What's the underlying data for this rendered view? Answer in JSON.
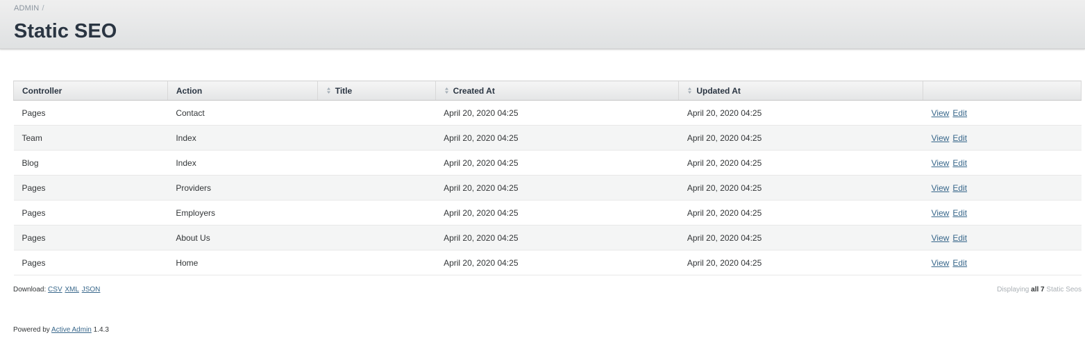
{
  "breadcrumb": {
    "items": [
      "ADMIN"
    ],
    "separator": "/"
  },
  "page": {
    "title": "Static SEO"
  },
  "table": {
    "columns": [
      {
        "label": "Controller",
        "sortable": false
      },
      {
        "label": "Action",
        "sortable": false
      },
      {
        "label": "Title",
        "sortable": true
      },
      {
        "label": "Created At",
        "sortable": true
      },
      {
        "label": "Updated At",
        "sortable": true
      },
      {
        "label": "",
        "sortable": false
      }
    ],
    "rows": [
      {
        "controller": "Pages",
        "action": "Contact",
        "title": "",
        "created_at": "April 20, 2020 04:25",
        "updated_at": "April 20, 2020 04:25",
        "view": "View",
        "edit": "Edit"
      },
      {
        "controller": "Team",
        "action": "Index",
        "title": "",
        "created_at": "April 20, 2020 04:25",
        "updated_at": "April 20, 2020 04:25",
        "view": "View",
        "edit": "Edit"
      },
      {
        "controller": "Blog",
        "action": "Index",
        "title": "",
        "created_at": "April 20, 2020 04:25",
        "updated_at": "April 20, 2020 04:25",
        "view": "View",
        "edit": "Edit"
      },
      {
        "controller": "Pages",
        "action": "Providers",
        "title": "",
        "created_at": "April 20, 2020 04:25",
        "updated_at": "April 20, 2020 04:25",
        "view": "View",
        "edit": "Edit"
      },
      {
        "controller": "Pages",
        "action": "Employers",
        "title": "",
        "created_at": "April 20, 2020 04:25",
        "updated_at": "April 20, 2020 04:25",
        "view": "View",
        "edit": "Edit"
      },
      {
        "controller": "Pages",
        "action": "About Us",
        "title": "",
        "created_at": "April 20, 2020 04:25",
        "updated_at": "April 20, 2020 04:25",
        "view": "View",
        "edit": "Edit"
      },
      {
        "controller": "Pages",
        "action": "Home",
        "title": "",
        "created_at": "April 20, 2020 04:25",
        "updated_at": "April 20, 2020 04:25",
        "view": "View",
        "edit": "Edit"
      }
    ]
  },
  "download": {
    "label": "Download:",
    "formats": [
      "CSV",
      "XML",
      "JSON"
    ]
  },
  "pagination": {
    "prefix": "Displaying",
    "count": "all 7",
    "suffix": "Static Seos"
  },
  "footer": {
    "prefix": "Powered by",
    "link": "Active Admin",
    "version": "1.4.3"
  },
  "colors": {
    "link": "#38678b",
    "title": "#2a3542",
    "header_bg": "#e4e5e6",
    "even_row": "#f4f5f5"
  }
}
